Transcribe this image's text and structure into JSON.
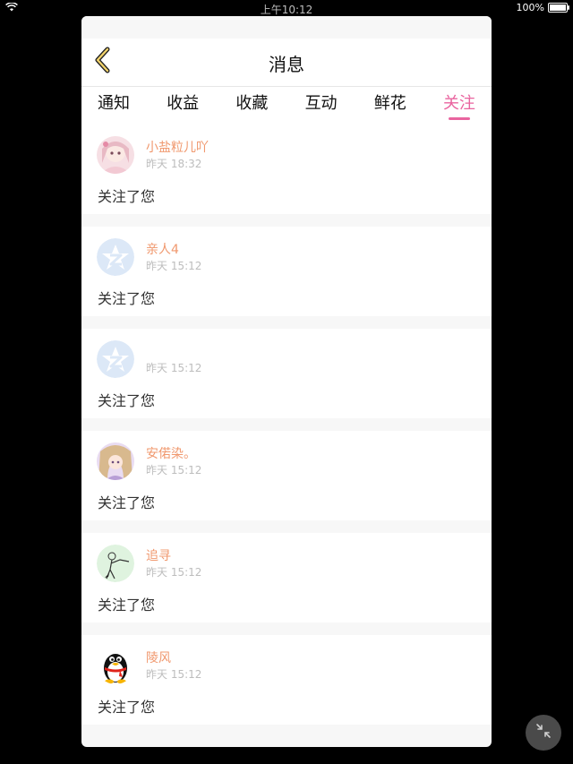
{
  "status_bar": {
    "time": "上午10:12",
    "battery": "100%"
  },
  "nav": {
    "title": "消息"
  },
  "tabs": [
    {
      "label": "通知"
    },
    {
      "label": "收益"
    },
    {
      "label": "收藏"
    },
    {
      "label": "互动"
    },
    {
      "label": "鲜花"
    },
    {
      "label": "关注"
    }
  ],
  "active_tab": "关注",
  "colors": {
    "accent": "#e9649f",
    "name": "#f0986e",
    "time": "#bdbdbd"
  },
  "items": [
    {
      "name": "小盐粒儿吖",
      "time": "昨天 18:32",
      "message": "关注了您",
      "avatar": "anime-girl-pink-avatar"
    },
    {
      "name": "亲人4",
      "time": "昨天 15:12",
      "message": "关注了您",
      "avatar": "qzone-star-avatar"
    },
    {
      "name": "",
      "time": "昨天 15:12",
      "message": "关注了您",
      "avatar": "qzone-star-avatar"
    },
    {
      "name": "安偌染。",
      "time": "昨天 15:12",
      "message": "关注了您",
      "avatar": "anime-girl-purple-avatar"
    },
    {
      "name": "追寻",
      "time": "昨天 15:12",
      "message": "关注了您",
      "avatar": "sketch-figure-green-avatar"
    },
    {
      "name": "陵风",
      "time": "昨天 15:12",
      "message": "关注了您",
      "avatar": "qq-penguin-avatar"
    }
  ]
}
